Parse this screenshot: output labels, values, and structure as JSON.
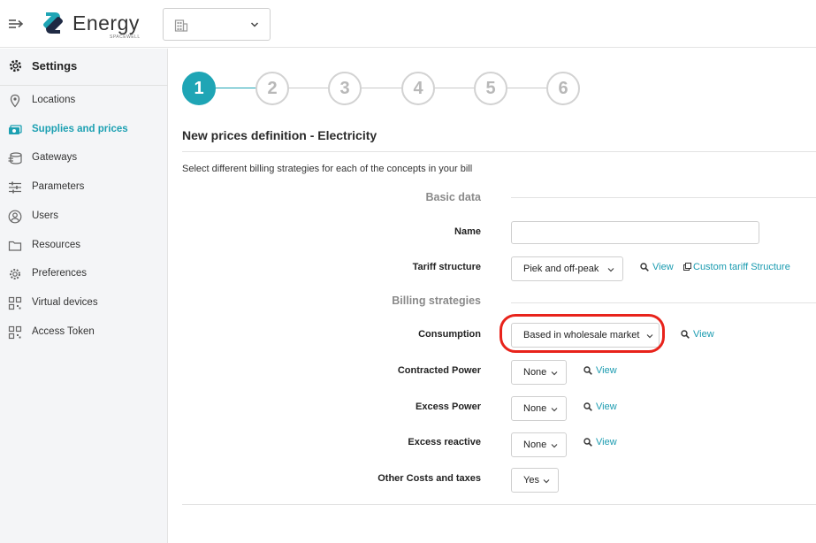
{
  "header": {
    "logo_text": "Energy",
    "logo_sub": "SPACEWELL",
    "site_select_value": ""
  },
  "sidebar": {
    "title": "Settings",
    "items": [
      {
        "label": "Locations",
        "icon": "location-pin-icon"
      },
      {
        "label": "Supplies and prices",
        "icon": "money-icon",
        "active": true
      },
      {
        "label": "Gateways",
        "icon": "gateway-icon"
      },
      {
        "label": "Parameters",
        "icon": "sliders-icon"
      },
      {
        "label": "Users",
        "icon": "user-icon"
      },
      {
        "label": "Resources",
        "icon": "folder-icon"
      },
      {
        "label": "Preferences",
        "icon": "gear-icon"
      },
      {
        "label": "Virtual devices",
        "icon": "grid-icon"
      },
      {
        "label": "Access Token",
        "icon": "grid-icon"
      }
    ]
  },
  "stepper": {
    "steps": [
      "1",
      "2",
      "3",
      "4",
      "5",
      "6"
    ],
    "current": 1
  },
  "main": {
    "title": "New prices definition - Electricity",
    "subtitle": "Select different billing strategies for each of the concepts in your bill",
    "basic_data_label": "Basic data",
    "name_label": "Name",
    "name_value": "",
    "tariff_label": "Tariff structure",
    "tariff_value": "Piek and off-peak",
    "view_label": "View",
    "custom_tariff_label": "Custom tariff Structure",
    "billing_label": "Billing strategies",
    "consumption_label": "Consumption",
    "consumption_value": "Based in wholesale market",
    "contracted_power_label": "Contracted Power",
    "contracted_power_value": "None",
    "excess_power_label": "Excess Power",
    "excess_power_value": "None",
    "excess_reactive_label": "Excess reactive",
    "excess_reactive_value": "None",
    "other_costs_label": "Other Costs and taxes",
    "other_costs_value": "Yes"
  },
  "colors": {
    "accent": "#1fa5b5",
    "link": "#1a9bb0",
    "highlight": "#e8231b"
  }
}
